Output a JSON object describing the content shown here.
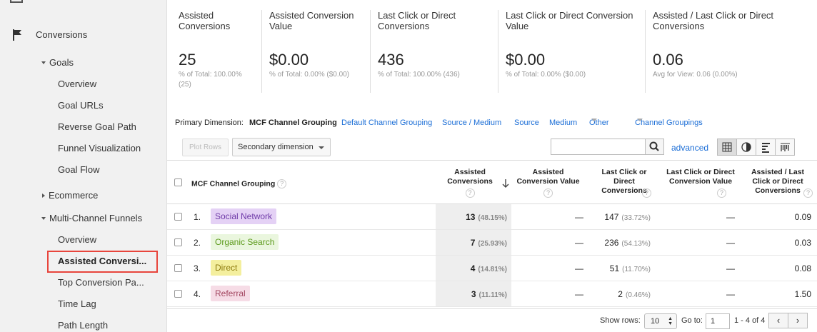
{
  "sidebar": {
    "section": "Conversions",
    "goals": "Goals",
    "goal_items": [
      "Overview",
      "Goal URLs",
      "Reverse Goal Path",
      "Funnel Visualization",
      "Goal Flow"
    ],
    "ecommerce": "Ecommerce",
    "mcf": "Multi-Channel Funnels",
    "mcf_items": [
      "Overview",
      "Assisted Conversi...",
      "Top Conversion Pa...",
      "Time Lag",
      "Path Length"
    ],
    "highlight_color": "#e8453c"
  },
  "summary": [
    {
      "label": "Assisted Conversions",
      "value": "25",
      "sub": "% of Total: 100.00% (25)"
    },
    {
      "label": "Assisted Conversion Value",
      "value": "$0.00",
      "sub": "% of Total: 0.00% ($0.00)"
    },
    {
      "label": "Last Click or Direct Conversions",
      "value": "436",
      "sub": "% of Total: 100.00% (436)"
    },
    {
      "label": "Last Click or Direct Conversion Value",
      "value": "$0.00",
      "sub": "% of Total: 0.00% ($0.00)"
    },
    {
      "label": "Assisted / Last Click or Direct Conversions",
      "value": "0.06",
      "sub": "Avg for View: 0.06 (0.00%)"
    }
  ],
  "dimensions": {
    "label": "Primary Dimension:",
    "current": "MCF Channel Grouping",
    "links": [
      "Default Channel Grouping",
      "Source / Medium",
      "Source",
      "Medium",
      "Other"
    ],
    "channel_groupings": "Channel Groupings"
  },
  "toolbar": {
    "plot_rows": "Plot Rows",
    "secondary": "Secondary dimension",
    "search_value": "",
    "advanced": "advanced",
    "view_icons": [
      "table-view-icon",
      "pie-view-icon",
      "performance-view-icon",
      "comparison-view-icon"
    ]
  },
  "table": {
    "headers": {
      "dimension": "MCF Channel Grouping",
      "c1": "Assisted Conversions",
      "c2": "Assisted Conversion Value",
      "c3": "Last Click or Direct Conversions",
      "c4": "Last Click or Direct Conversion Value",
      "c5": "Assisted / Last Click or Direct Conversions"
    },
    "rows": [
      {
        "num": "1.",
        "channel": "Social Network",
        "chip_bg": "#e4d1f5",
        "chip_fg": "#6f3aa8",
        "assisted": "13",
        "assisted_pct": "(48.15%)",
        "assisted_value": "—",
        "last": "147",
        "last_pct": "(33.72%)",
        "last_value": "—",
        "ratio": "0.09"
      },
      {
        "num": "2.",
        "channel": "Organic Search",
        "chip_bg": "#eaf6de",
        "chip_fg": "#5c9a1b",
        "assisted": "7",
        "assisted_pct": "(25.93%)",
        "assisted_value": "—",
        "last": "236",
        "last_pct": "(54.13%)",
        "last_value": "—",
        "ratio": "0.03"
      },
      {
        "num": "3.",
        "channel": "Direct",
        "chip_bg": "#f4ef9e",
        "chip_fg": "#8d7a0c",
        "assisted": "4",
        "assisted_pct": "(14.81%)",
        "assisted_value": "—",
        "last": "51",
        "last_pct": "(11.70%)",
        "last_value": "—",
        "ratio": "0.08"
      },
      {
        "num": "4.",
        "channel": "Referral",
        "chip_bg": "#f6dce6",
        "chip_fg": "#a2445f",
        "assisted": "3",
        "assisted_pct": "(11.11%)",
        "assisted_value": "—",
        "last": "2",
        "last_pct": "(0.46%)",
        "last_value": "—",
        "ratio": "1.50"
      }
    ]
  },
  "footer": {
    "show_rows_label": "Show rows:",
    "show_rows_value": "10",
    "goto_label": "Go to:",
    "goto_value": "1",
    "range": "1 - 4 of 4",
    "prev": "‹",
    "next": "›"
  }
}
